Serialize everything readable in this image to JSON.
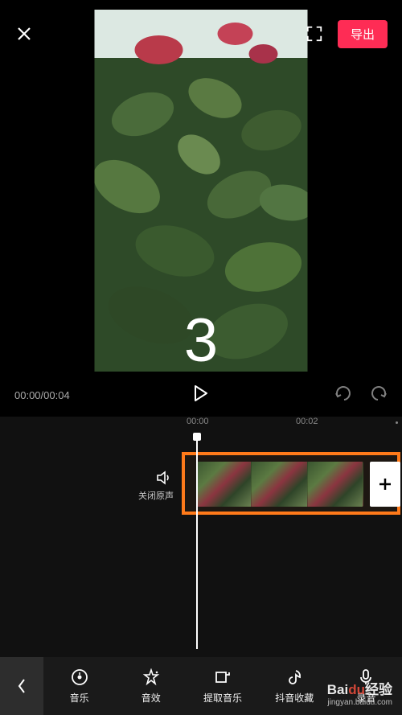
{
  "header": {
    "export_label": "导出"
  },
  "preview": {
    "overlay_number": "3"
  },
  "playback": {
    "current_time": "00:00",
    "total_time": "00:04"
  },
  "timeline": {
    "ruler": [
      "00:00",
      "00:02"
    ],
    "mute_label": "关闭原声"
  },
  "toolbar": {
    "items": [
      {
        "label": "音乐",
        "icon": "music-disc-icon"
      },
      {
        "label": "音效",
        "icon": "sound-effect-icon"
      },
      {
        "label": "提取音乐",
        "icon": "extract-music-icon"
      },
      {
        "label": "抖音收藏",
        "icon": "douyin-icon"
      },
      {
        "label": "录音",
        "icon": "microphone-icon"
      }
    ]
  },
  "watermark": {
    "brand_prefix": "Bai",
    "brand_suffix": "du",
    "brand_cn": "经验",
    "url": "jingyan.baidu.com"
  }
}
